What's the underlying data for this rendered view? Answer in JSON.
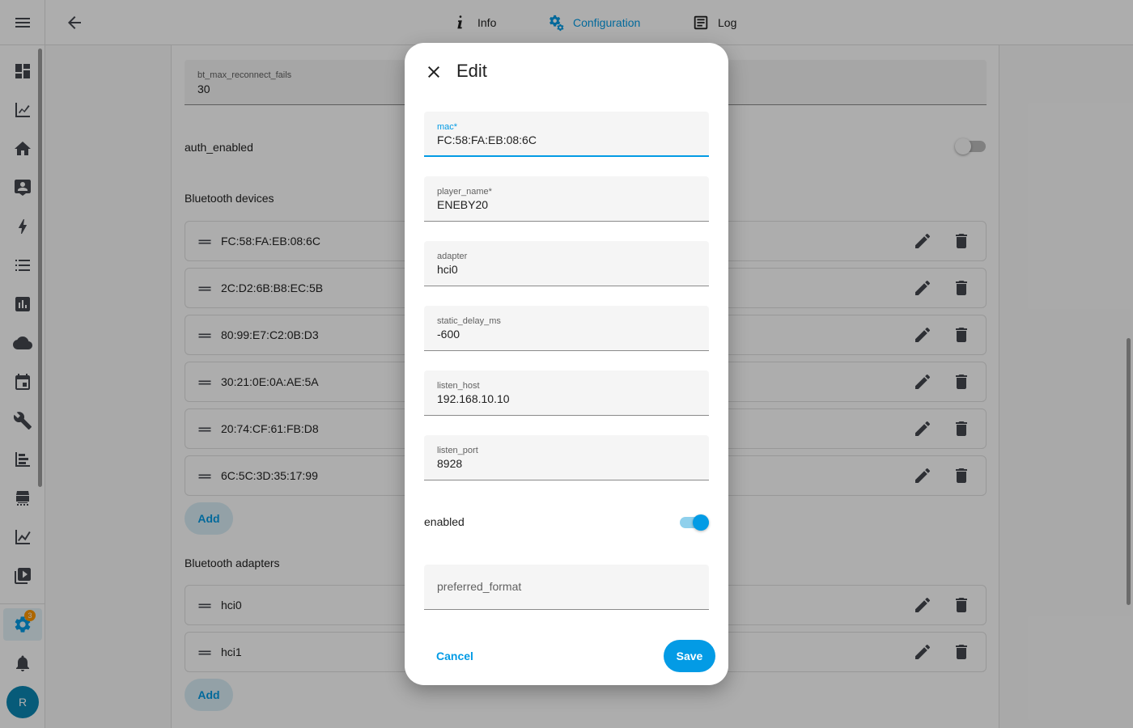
{
  "header": {
    "tabs": [
      {
        "label": "Info",
        "icon": "info-icon"
      },
      {
        "label": "Configuration",
        "icon": "cogs-icon",
        "active": true
      },
      {
        "label": "Log",
        "icon": "log-icon"
      }
    ]
  },
  "sidebar": {
    "items": [
      "dashboard-icon",
      "chart-line-icon",
      "home-icon",
      "person-board-icon",
      "lightning-icon",
      "list-icon",
      "bar-chart-icon",
      "cloud-icon",
      "calendar-icon",
      "wrench-icon",
      "timeline-icon",
      "hacs-store-icon",
      "trend-icon",
      "media-icon"
    ],
    "settings_badge": "3",
    "avatar_initial": "R"
  },
  "config": {
    "bt_max_reconnect_fails": {
      "label": "bt_max_reconnect_fails",
      "value": "30"
    },
    "auth_enabled_label": "auth_enabled",
    "auth_enabled": false,
    "bluetooth_devices_title": "Bluetooth devices",
    "devices": [
      "FC:58:FA:EB:08:6C",
      "2C:D2:6B:B8:EC:5B",
      "80:99:E7:C2:0B:D3",
      "30:21:0E:0A:AE:5A",
      "20:74:CF:61:FB:D8",
      "6C:5C:3D:35:17:99"
    ],
    "add_label": "Add",
    "bluetooth_adapters_title": "Bluetooth adapters",
    "adapters": [
      "hci0",
      "hci1"
    ]
  },
  "dialog": {
    "title": "Edit",
    "fields": {
      "mac": {
        "label": "mac*",
        "value": "FC:58:FA:EB:08:6C"
      },
      "player_name": {
        "label": "player_name*",
        "value": "ENEBY20"
      },
      "adapter": {
        "label": "adapter",
        "value": "hci0"
      },
      "static_delay_ms": {
        "label": "static_delay_ms",
        "value": "-600"
      },
      "listen_host": {
        "label": "listen_host",
        "value": "192.168.10.10"
      },
      "listen_port": {
        "label": "listen_port",
        "value": "8928"
      },
      "preferred_format": {
        "placeholder": "preferred_format",
        "value": ""
      }
    },
    "enabled_label": "enabled",
    "enabled": true,
    "cancel_label": "Cancel",
    "save_label": "Save"
  },
  "colors": {
    "accent": "#039be5",
    "badge": "#ff9800"
  }
}
